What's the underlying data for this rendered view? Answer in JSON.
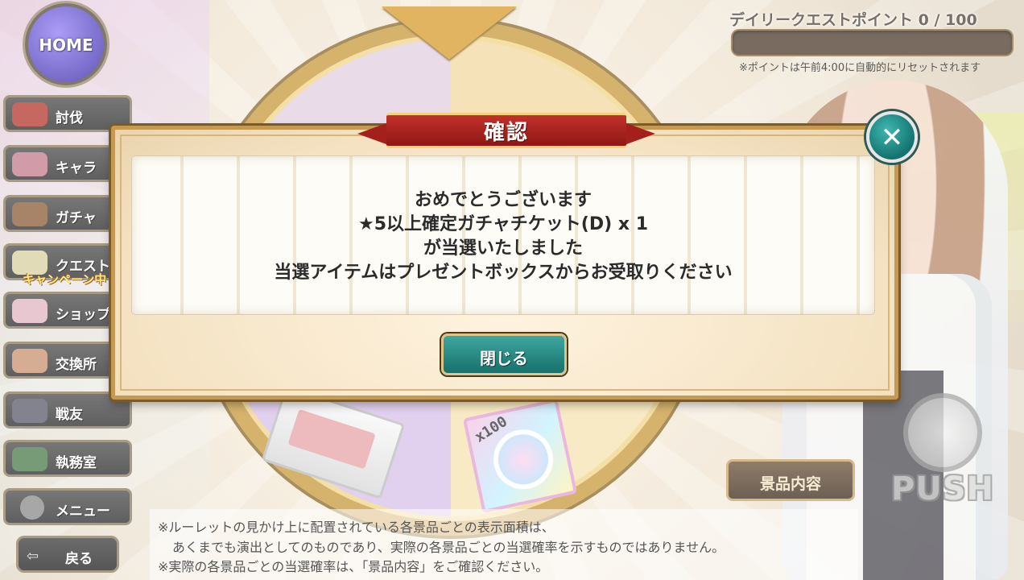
{
  "hud": {
    "daily_title": "デイリークエストポイント 0 / 100",
    "daily_progress": 0,
    "daily_note": "※ポイントは午前4:00に自動的にリセットされます"
  },
  "sidebar": {
    "home": "HOME",
    "items": [
      {
        "label": "討伐"
      },
      {
        "label": "キャラ"
      },
      {
        "label": "ガチャ"
      },
      {
        "label": "クエスト"
      },
      {
        "label": "ショップ"
      },
      {
        "label": "交換所"
      },
      {
        "label": "戦友"
      },
      {
        "label": "執務室"
      },
      {
        "label": "メニュー"
      }
    ],
    "campaign_badge": "キャンペーン中",
    "back": "戻る"
  },
  "roulette": {
    "prize_ticket_count": "x100"
  },
  "prize_list_button": "景品内容",
  "push_label": "PUSH",
  "notes": [
    "※ルーレットの見かけ上に配置されている各景品ごとの表示面積は、",
    "あくまでも演出としてのものであり、実際の各景品ごとの当選確率を示すものではありません。",
    "※実際の各景品ごとの当選確率は、「景品内容」をご確認ください。"
  ],
  "dialog": {
    "title": "確認",
    "lines": [
      "おめでとうございます",
      "★5以上確定ガチャチケット(D) x 1",
      "が当選いたしました",
      "当選アイテムはプレゼントボックスからお受取りください"
    ],
    "close_button": "閉じる",
    "close_icon": "close-icon"
  }
}
